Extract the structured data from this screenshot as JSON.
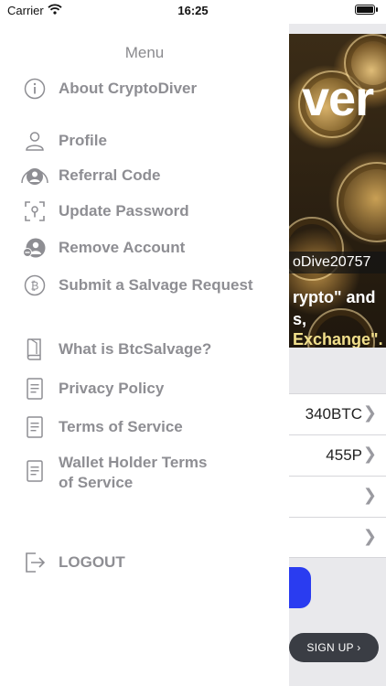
{
  "status_bar": {
    "carrier": "Carrier",
    "time": "16:25"
  },
  "drawer": {
    "title": "Menu",
    "items": [
      {
        "label": "About CryptoDiver",
        "icon": "info-icon"
      },
      {
        "label": "Profile",
        "icon": "person-icon"
      },
      {
        "label": "Referral Code",
        "icon": "referral-icon"
      },
      {
        "label": "Update Password",
        "icon": "lock-scan-icon"
      },
      {
        "label": "Remove Account",
        "icon": "remove-person-icon"
      },
      {
        "label": "Submit a Salvage Request",
        "icon": "bitcoin-icon"
      },
      {
        "label": "What is BtcSalvage?",
        "icon": "book-icon"
      },
      {
        "label": "Privacy Policy",
        "icon": "document-icon"
      },
      {
        "label": "Terms of Service",
        "icon": "document-icon"
      },
      {
        "label": "Wallet Holder Terms\nof Service",
        "label_line1": "Wallet Holder Terms",
        "label_line2": "of Service",
        "icon": "document-icon"
      },
      {
        "label": "LOGOUT",
        "icon": "logout-icon"
      }
    ]
  },
  "background": {
    "hero_title_fragment": "ver",
    "hero_user_fragment": "oDive20757",
    "hero_text_line1": "rypto\" and",
    "hero_text_line2": "s,",
    "hero_text_line3": "Exchange\".",
    "rows": [
      {
        "value": "340BTC"
      },
      {
        "value": "455P"
      },
      {
        "value": ""
      },
      {
        "value": ""
      }
    ],
    "signup_label": "SIGN UP"
  }
}
